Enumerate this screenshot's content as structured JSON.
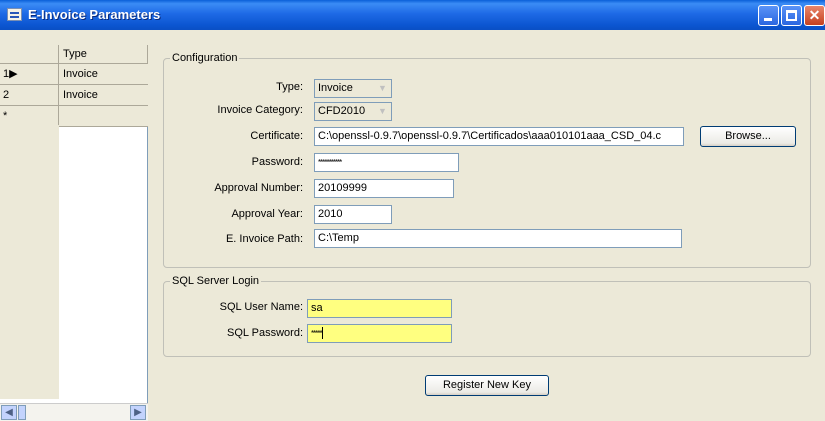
{
  "window": {
    "title": "E-Invoice Parameters"
  },
  "grid": {
    "column_header": "Type",
    "rows": [
      {
        "indicator": "1▶",
        "type": "Invoice"
      },
      {
        "indicator": "2",
        "type": "Invoice"
      },
      {
        "indicator": "*",
        "type": ""
      }
    ]
  },
  "configuration": {
    "legend": "Configuration",
    "type_label": "Type:",
    "type_value": "Invoice",
    "category_label": "Invoice Category:",
    "category_value": "CFD2010",
    "certificate_label": "Certificate:",
    "certificate_value": "C:\\openssl-0.9.7\\openssl-0.9.7\\Certificados\\aaa010101aaa_CSD_04.c",
    "browse_label": "Browse...",
    "password_label": "Password:",
    "password_value": "***********",
    "approval_number_label": "Approval Number:",
    "approval_number_value": "20109999",
    "approval_year_label": "Approval Year:",
    "approval_year_value": "2010",
    "path_label": "E. Invoice Path:",
    "path_value": "C:\\Temp"
  },
  "sql": {
    "legend": "SQL Server Login",
    "user_label": "SQL User Name:",
    "user_value": "sa",
    "password_label": "SQL Password:",
    "password_value": "*****",
    "field_color": "#ffff80"
  },
  "register_label": "Register New Key"
}
